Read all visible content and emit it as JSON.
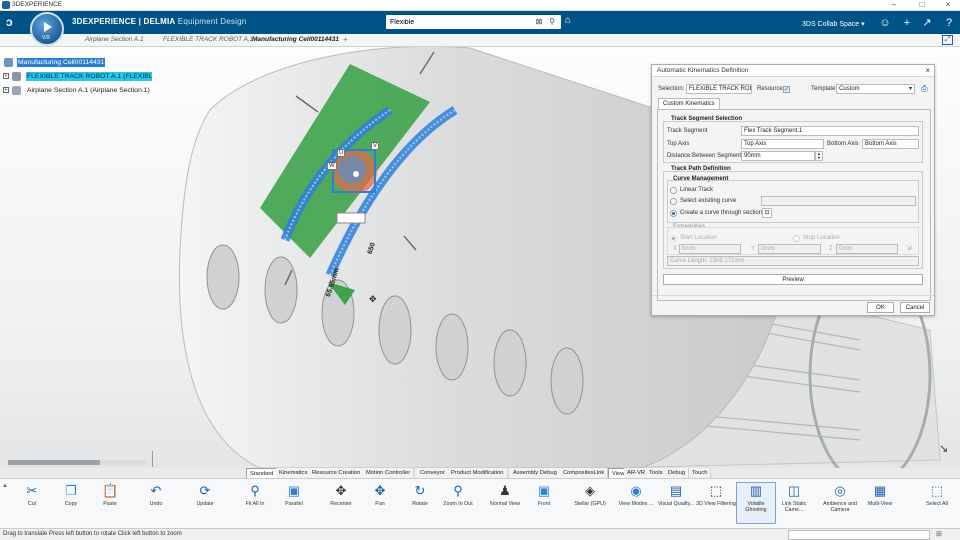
{
  "os": {
    "title": "3DEXPERIENCE"
  },
  "header": {
    "brand_prefix": "3D",
    "brand_main": "EXPERIENCE | DELMIA",
    "brand_app": "Equipment Design",
    "compass_version": "V.R",
    "search_value": "Flexible",
    "collab_space": "3DS Collab Space",
    "accent": "#005386"
  },
  "tabs": [
    {
      "label": "Airplane Section A.1"
    },
    {
      "label": "FLEXIBLE TRACK ROBOT A.1"
    },
    {
      "label": "Manufacturing Cell00114431"
    }
  ],
  "tree": [
    {
      "label": "Manufacturing Cell00114431",
      "icon": "cell-icon"
    },
    {
      "label": "FLEXIBLE TRACK ROBOT A.1 (FLEXIBLE T",
      "icon": "robot-icon"
    },
    {
      "label": "Airplane Section A.1 (Airplane Section.1)",
      "icon": "part-icon"
    }
  ],
  "viewport": {
    "dimension_1": "65.65mm",
    "dimension_2": "650",
    "robot_axis_u": "U",
    "robot_axis_v": "V",
    "robot_axis_w": "W"
  },
  "dialog": {
    "title": "Automatic Kinematics Definition",
    "selection_label": "Selection:",
    "selection_value": "FLEXIBLE TRACK ROBOT",
    "resource_label": "Resource",
    "template_label": "Template:",
    "template_value": "Custom",
    "tab": "Custom Kinematics",
    "track_segment_selection": {
      "title": "Track Segment Selection",
      "track_segment_label": "Track Segment",
      "track_segment_value": "Flex Track Segment.1",
      "top_axis_label": "Top Axis",
      "top_axis_value": "Top Axis",
      "bottom_axis_label": "Bottom Axis",
      "bottom_axis_value": "Bottom Axis",
      "distance_label": "Distance Between Segments",
      "distance_value": "90mm"
    },
    "track_path_definition": {
      "title": "Track Path Definition",
      "curve_management": "Curve Management",
      "linear_track": "Linear Track",
      "select_existing": "Select exisiting curve",
      "create_curve": "Create a curve through sections",
      "extremities": "Extremities",
      "start_location": "Start Location",
      "stop_location": "Stop Location",
      "x_label": "X",
      "x_value": "0mm",
      "y_label": "Y",
      "y_value": "0mm",
      "z_label": "Z",
      "z_value": "0mm",
      "curve_length": "Curve Length: 2306.172mm"
    },
    "preview_button": "Preview",
    "ok_button": "OK",
    "cancel_button": "Cancel"
  },
  "section_tabs": [
    "Standard",
    "Kinematics",
    "Resource Creation",
    "Motion Controller",
    "Conveyor",
    "Product Modification",
    "Assembly Debug",
    "CompositesLink",
    "View",
    "AR-VR",
    "Tools",
    "Debug",
    "Touch"
  ],
  "toolbar": [
    {
      "label": "Cut",
      "icon": "cut-icon"
    },
    {
      "label": "Copy",
      "icon": "copy-icon"
    },
    {
      "label": "Paste",
      "icon": "paste-icon"
    },
    {
      "label": "Undo",
      "icon": "undo-icon"
    },
    {
      "label": "Update",
      "icon": "update-icon"
    },
    {
      "label": "Fit All In",
      "icon": "fit-all-icon"
    },
    {
      "label": "Parallel",
      "icon": "parallel-icon"
    },
    {
      "label": "Recenter",
      "icon": "recenter-icon"
    },
    {
      "label": "Pan",
      "icon": "pan-icon"
    },
    {
      "label": "Rotate",
      "icon": "rotate-icon"
    },
    {
      "label": "Zoom In Out",
      "icon": "zoom-icon"
    },
    {
      "label": "Normal View",
      "icon": "normal-view-icon"
    },
    {
      "label": "Front",
      "icon": "front-view-icon"
    },
    {
      "label": "Stellar (GPU)",
      "icon": "stellar-icon"
    },
    {
      "label": "View Modes ...",
      "icon": "view-modes-icon"
    },
    {
      "label": "Visual Quality...",
      "icon": "visual-quality-icon"
    },
    {
      "label": "3D View Filtering",
      "icon": "view-filter-icon"
    },
    {
      "label": "Volatile Ghosting",
      "icon": "ghosting-icon"
    },
    {
      "label": "Link Static Came...",
      "icon": "link-camera-icon"
    },
    {
      "label": "Ambience and Camera",
      "icon": "ambience-icon"
    },
    {
      "label": "Multi-View",
      "icon": "multi-view-icon"
    },
    {
      "label": "Select All",
      "icon": "select-all-icon"
    }
  ],
  "status": {
    "text": "Drag to translate  Press left button to rotate  Click left button to zoom"
  }
}
